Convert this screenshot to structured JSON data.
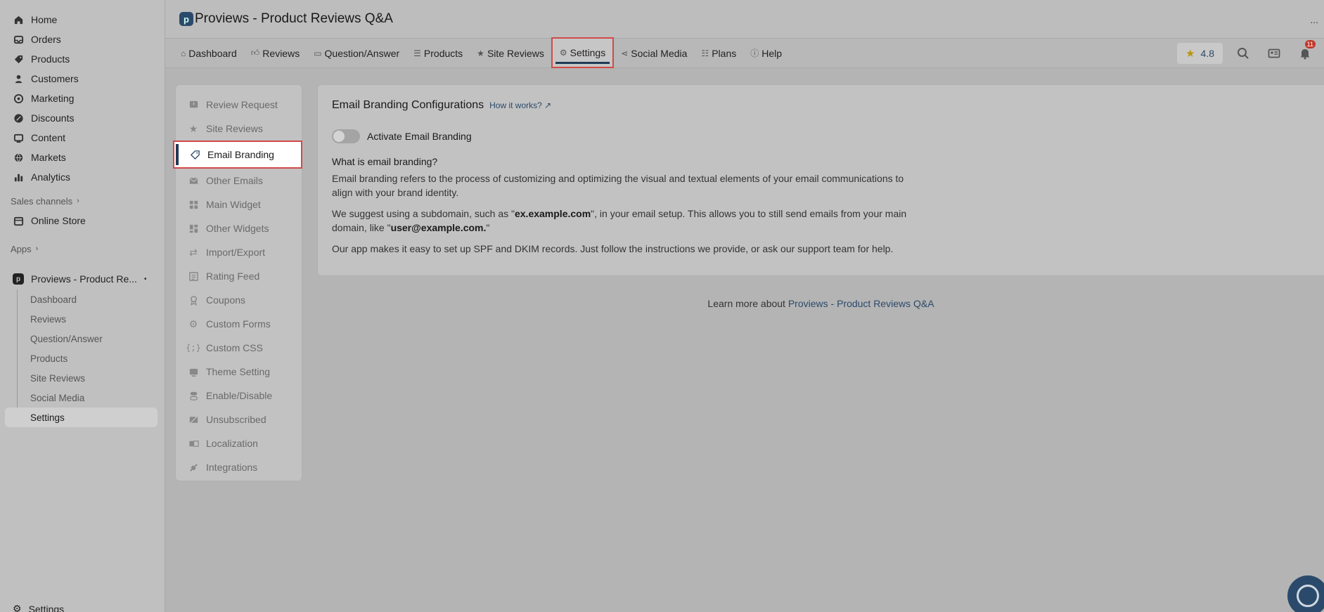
{
  "admin_nav": {
    "items": [
      {
        "label": "Home",
        "icon": "home-icon"
      },
      {
        "label": "Orders",
        "icon": "inbox-icon"
      },
      {
        "label": "Products",
        "icon": "tag-icon"
      },
      {
        "label": "Customers",
        "icon": "person-icon"
      },
      {
        "label": "Marketing",
        "icon": "target-icon"
      },
      {
        "label": "Discounts",
        "icon": "discount-icon"
      },
      {
        "label": "Content",
        "icon": "content-icon"
      },
      {
        "label": "Markets",
        "icon": "globe-icon"
      },
      {
        "label": "Analytics",
        "icon": "bar-chart-icon"
      }
    ],
    "sales_channels_label": "Sales channels",
    "online_store_label": "Online Store",
    "apps_label": "Apps",
    "app_name": "Proviews - Product Re...",
    "app_sub_items": [
      "Dashboard",
      "Reviews",
      "Question/Answer",
      "Products",
      "Site Reviews",
      "Social Media",
      "Settings"
    ],
    "bottom_settings_label": "Settings"
  },
  "header": {
    "title": "Proviews - Product Reviews Q&A",
    "more": "..."
  },
  "tabs": [
    "Dashboard",
    "Reviews",
    "Question/Answer",
    "Products",
    "Site Reviews",
    "Settings",
    "Social Media",
    "Plans",
    "Help"
  ],
  "active_tab": "Settings",
  "rating": "4.8",
  "notification_count": "11",
  "settings_menu": [
    "Review Request",
    "Site Reviews",
    "Email Branding",
    "Other Emails",
    "Main Widget",
    "Other Widgets",
    "Import/Export",
    "Rating Feed",
    "Coupons",
    "Custom Forms",
    "Custom CSS",
    "Theme Setting",
    "Enable/Disable",
    "Unsubscribed",
    "Localization",
    "Integrations"
  ],
  "active_setting": "Email Branding",
  "card": {
    "title": "Email Branding Configurations",
    "how_link": "How it works?",
    "toggle_label": "Activate Email Branding",
    "question": "What is email branding?",
    "para1": "Email branding refers to the process of customizing and optimizing the visual and textual elements of your email communications to align with your brand identity.",
    "para2_a": "We suggest using a subdomain, such as \"",
    "para2_b": "ex.example.com",
    "para2_c": "\", in your email setup. This allows you to still send emails from your main domain, like \"",
    "para2_d": "user@example.com.",
    "para2_e": "\"",
    "para3": "Our app makes it easy to set up SPF and DKIM records. Just follow the instructions we provide, or ask our support team for help."
  },
  "learn_more": {
    "prefix": "Learn more about ",
    "link": "Proviews - Product Reviews Q&A"
  }
}
